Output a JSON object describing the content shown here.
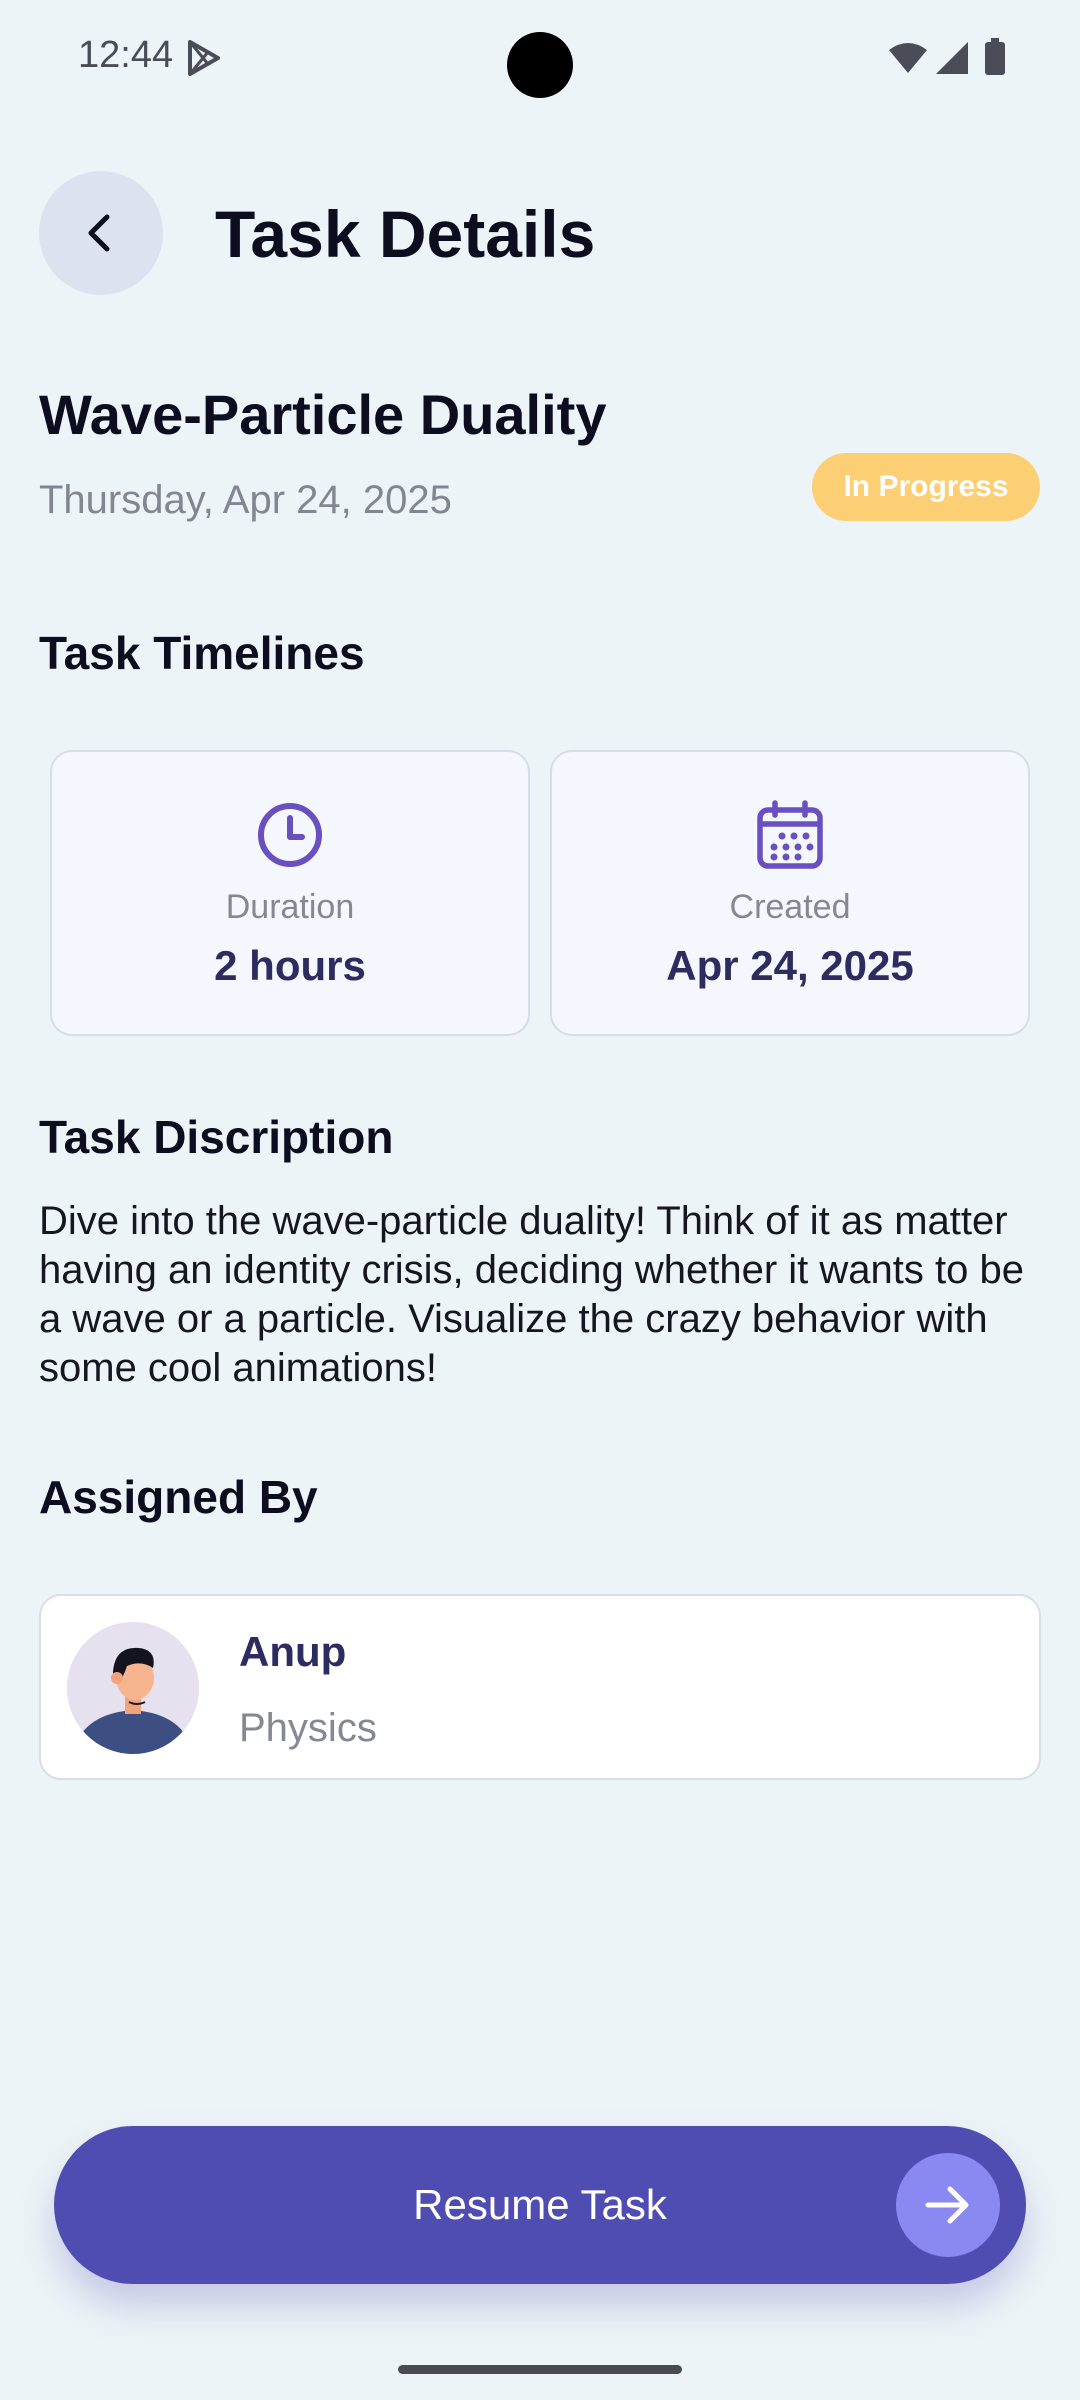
{
  "status_bar": {
    "time": "12:44"
  },
  "header": {
    "title": "Task Details"
  },
  "task": {
    "title": "Wave-Particle Duality",
    "date": "Thursday, Apr 24, 2025",
    "status": "In Progress"
  },
  "timelines": {
    "heading": "Task Timelines",
    "cards": [
      {
        "label": "Duration",
        "value": "2 hours",
        "icon": "clock-icon"
      },
      {
        "label": "Created",
        "value": "Apr 24, 2025",
        "icon": "calendar-icon"
      }
    ]
  },
  "description": {
    "heading": "Task Discription",
    "text": "Dive into the wave-particle duality! Think of it as matter having an identity crisis, deciding whether it wants to be a wave or a particle. Visualize the crazy behavior with some cool animations!"
  },
  "assigned": {
    "heading": "Assigned By",
    "name": "Anup",
    "subject": "Physics"
  },
  "action": {
    "label": "Resume Task"
  },
  "colors": {
    "background": "#edf4f7",
    "accent": "#4f4db2",
    "accent_light": "#8a88f1",
    "badge": "#fccf74",
    "icon": "#6a4fc0"
  }
}
